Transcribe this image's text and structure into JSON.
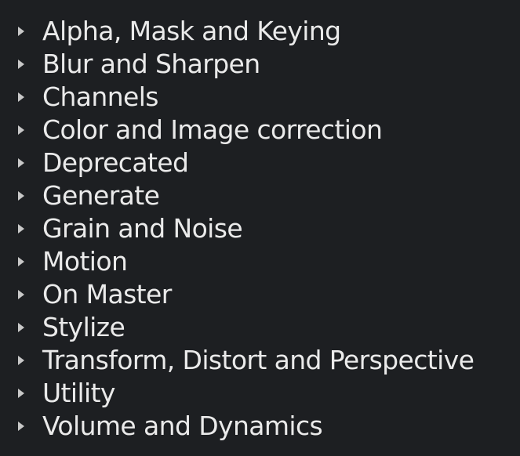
{
  "tree": {
    "items": [
      {
        "label": "Alpha, Mask and Keying"
      },
      {
        "label": "Blur and Sharpen"
      },
      {
        "label": "Channels"
      },
      {
        "label": "Color and Image correction"
      },
      {
        "label": "Deprecated"
      },
      {
        "label": "Generate"
      },
      {
        "label": "Grain and Noise"
      },
      {
        "label": "Motion"
      },
      {
        "label": "On Master"
      },
      {
        "label": "Stylize"
      },
      {
        "label": "Transform, Distort and Perspective"
      },
      {
        "label": "Utility"
      },
      {
        "label": "Volume and Dynamics"
      }
    ],
    "expander_icon": "chevron-right-icon",
    "colors": {
      "background": "#1d1f22",
      "text": "#eaeaea",
      "expander": "#c8c8c8"
    }
  }
}
